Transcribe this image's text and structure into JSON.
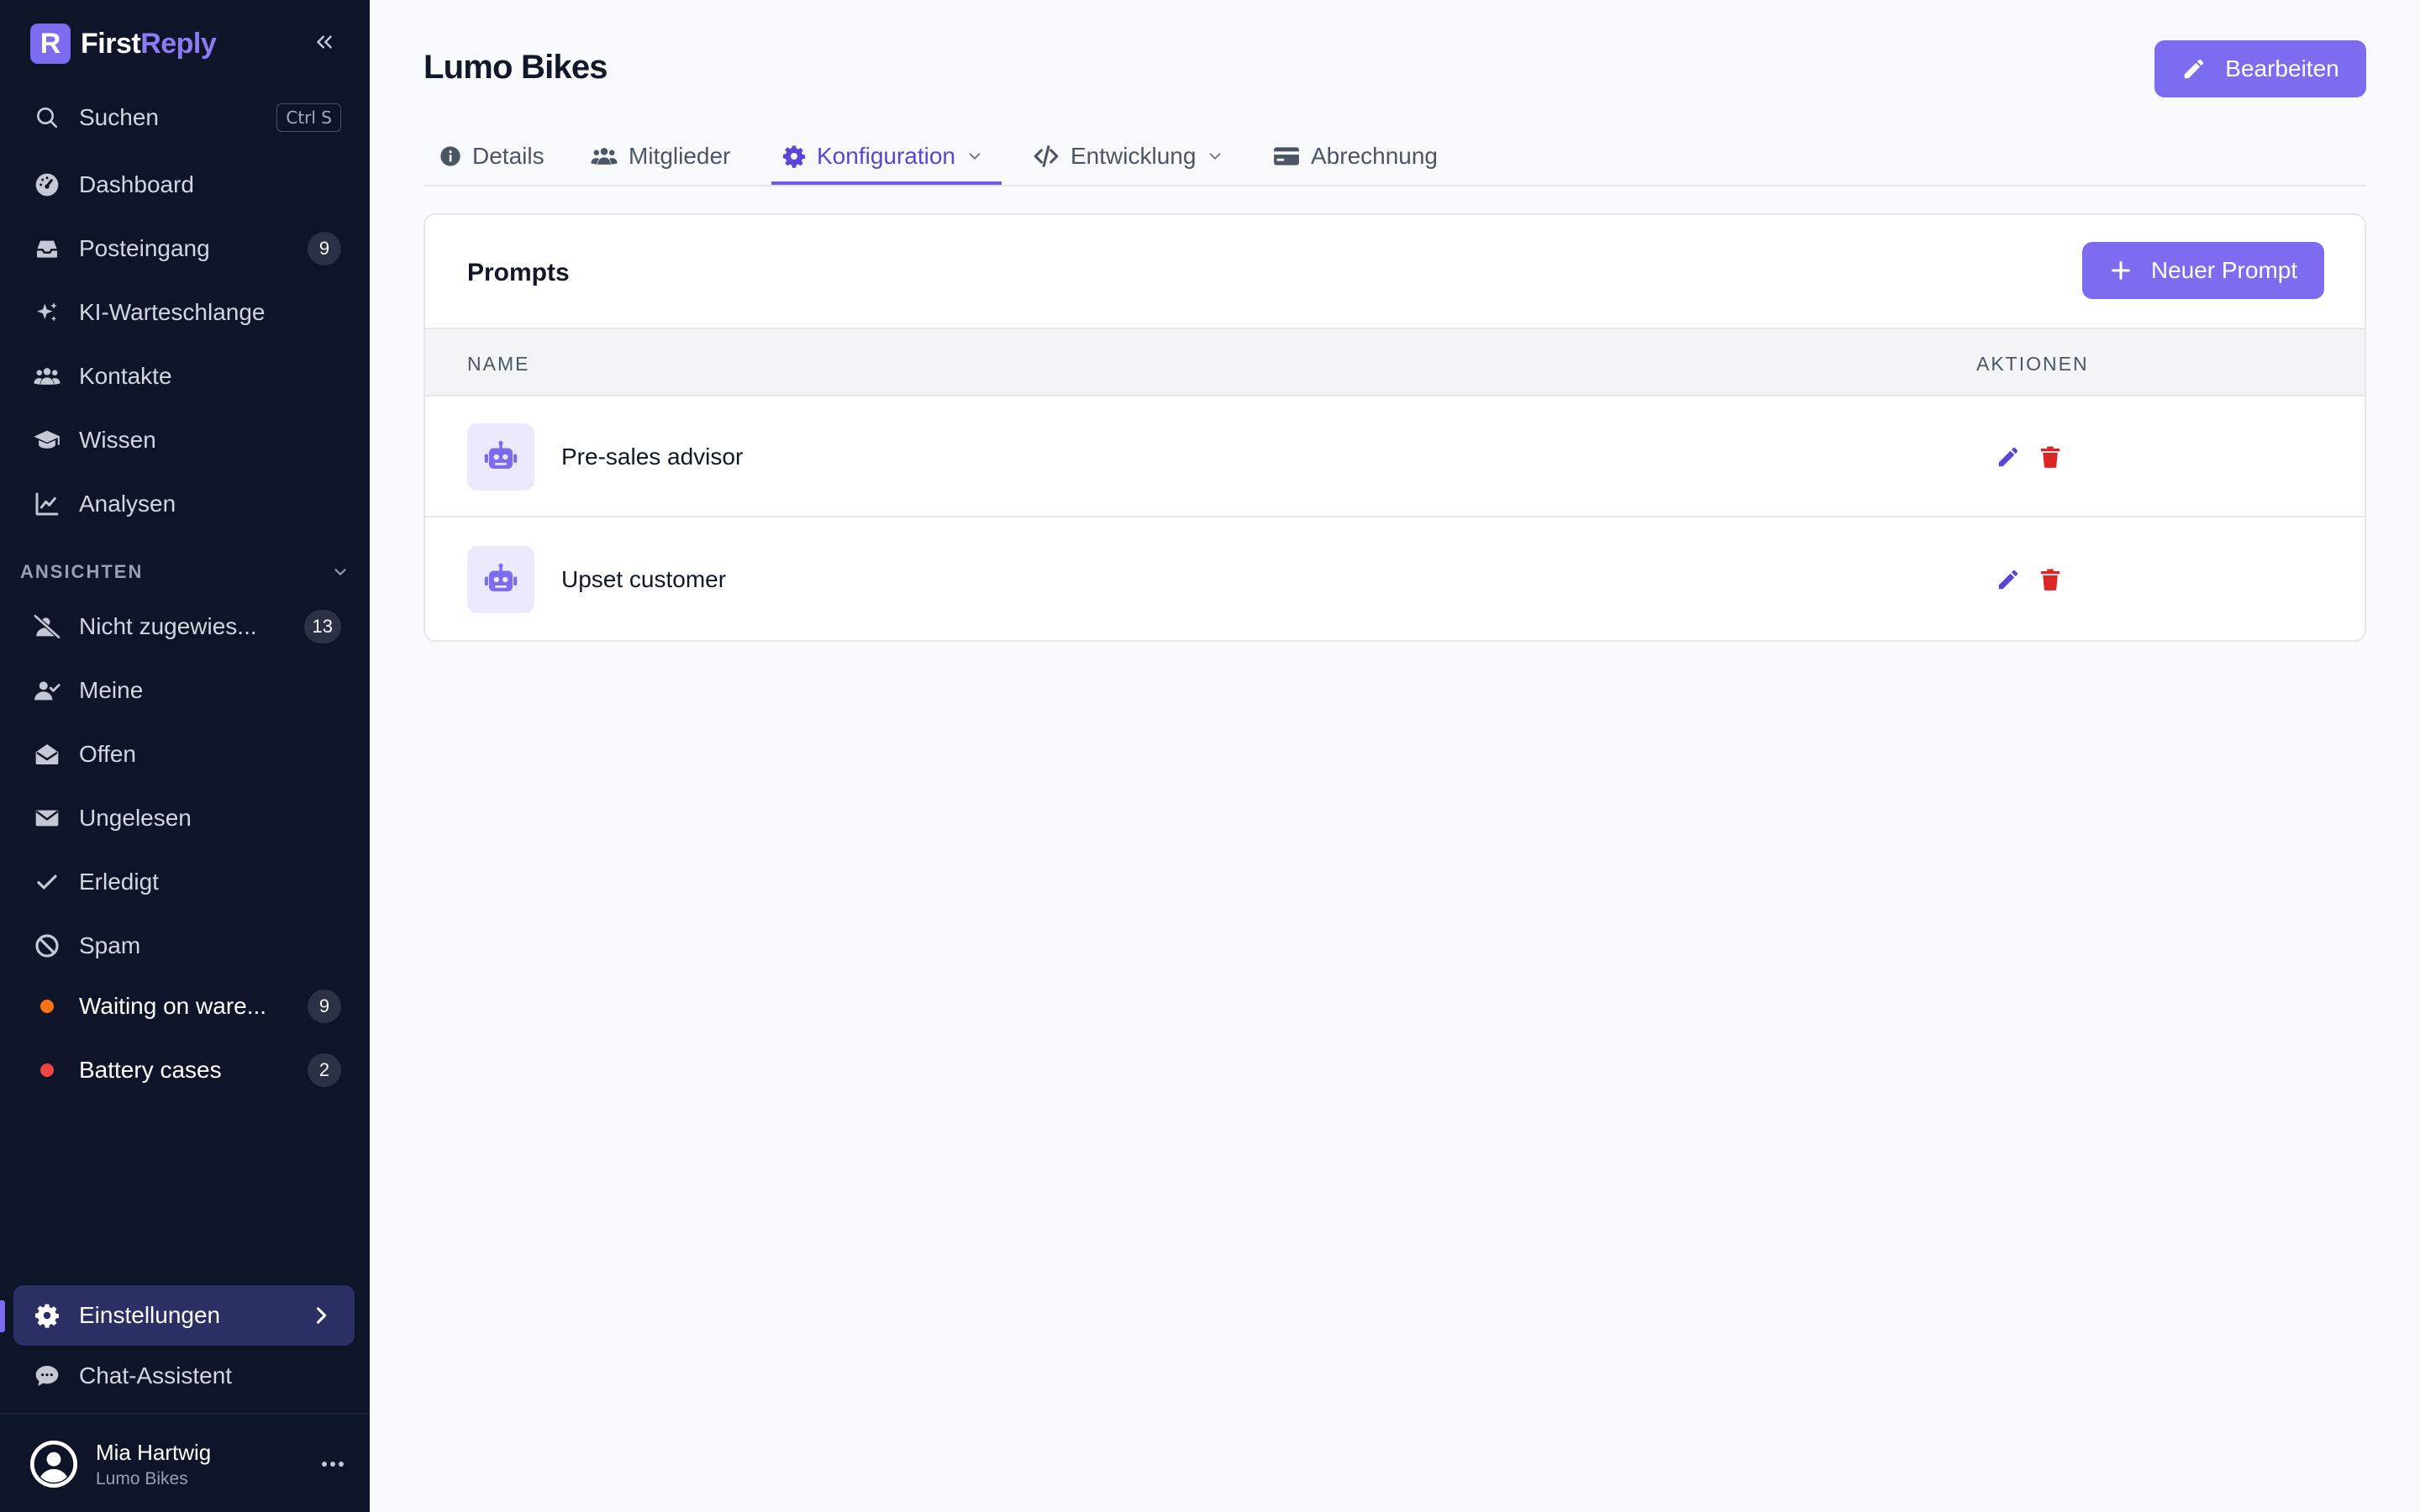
{
  "brand": {
    "name_first": "First",
    "name_second": "Reply",
    "logo_letter": "R"
  },
  "search": {
    "label": "Suchen",
    "shortcut": "Ctrl S"
  },
  "nav": [
    {
      "label": "Dashboard",
      "icon": "gauge-icon"
    },
    {
      "label": "Posteingang",
      "icon": "inbox-icon",
      "badge": "9"
    },
    {
      "label": "KI-Warteschlange",
      "icon": "sparkles-icon"
    },
    {
      "label": "Kontakte",
      "icon": "users-icon"
    },
    {
      "label": "Wissen",
      "icon": "graduation-cap-icon"
    },
    {
      "label": "Analysen",
      "icon": "chart-line-icon"
    }
  ],
  "views_section": {
    "label": "ANSICHTEN"
  },
  "views": [
    {
      "label": "Nicht zugewies...",
      "icon": "user-slash-icon",
      "badge": "13"
    },
    {
      "label": "Meine",
      "icon": "user-check-icon"
    },
    {
      "label": "Offen",
      "icon": "envelope-open-icon"
    },
    {
      "label": "Ungelesen",
      "icon": "envelope-icon"
    },
    {
      "label": "Erledigt",
      "icon": "check-icon"
    },
    {
      "label": "Spam",
      "icon": "ban-icon"
    },
    {
      "label": "Waiting on ware...",
      "dot_color": "#f97316",
      "badge": "9"
    },
    {
      "label": "Battery cases",
      "dot_color": "#ef4444",
      "badge": "2"
    }
  ],
  "bottom_nav": {
    "settings": "Einstellungen",
    "chat": "Chat-Assistent"
  },
  "user": {
    "name": "Mia Hartwig",
    "org": "Lumo Bikes"
  },
  "page": {
    "title": "Lumo Bikes",
    "edit_label": "Bearbeiten"
  },
  "tabs": [
    {
      "label": "Details",
      "icon": "info-circle-icon"
    },
    {
      "label": "Mitglieder",
      "icon": "users-icon"
    },
    {
      "label": "Konfiguration",
      "icon": "gear-icon",
      "active": true
    },
    {
      "label": "Entwicklung",
      "icon": "code-icon"
    },
    {
      "label": "Abrechnung",
      "icon": "credit-card-icon"
    }
  ],
  "prompts": {
    "title": "Prompts",
    "new_label": "Neuer Prompt",
    "columns": [
      "NAME",
      "AKTIONEN"
    ],
    "rows": [
      {
        "name": "Pre-sales advisor",
        "icon": "robot-icon"
      },
      {
        "name": "Upset customer",
        "icon": "robot-icon"
      }
    ]
  },
  "colors": {
    "accent": "#7c6cf0",
    "sidebar_bg": "#0f1529",
    "danger": "#dc2626",
    "edit_icon": "#5b45d6"
  }
}
